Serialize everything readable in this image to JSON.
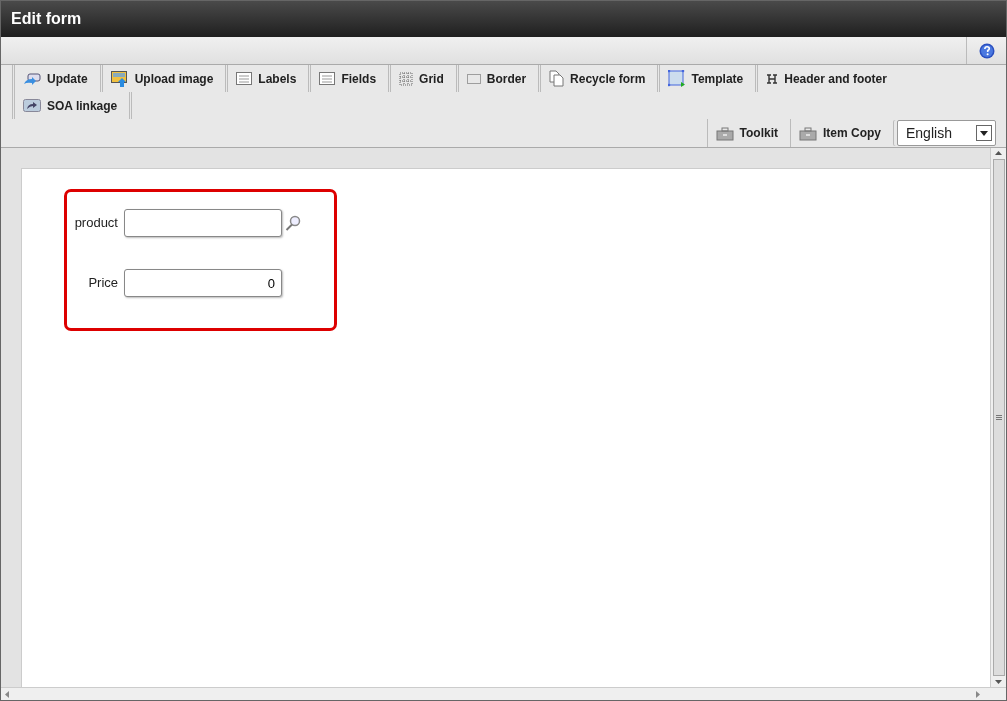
{
  "window": {
    "title": "Edit form"
  },
  "toolbar": [
    {
      "label": "Update"
    },
    {
      "label": "Upload image"
    },
    {
      "label": "Labels"
    },
    {
      "label": "Fields"
    },
    {
      "label": "Grid"
    },
    {
      "label": "Border"
    },
    {
      "label": "Recycle form"
    },
    {
      "label": "Template"
    },
    {
      "label": "Header and footer"
    },
    {
      "label": "SOA linkage"
    }
  ],
  "tools": [
    {
      "label": "Toolkit"
    },
    {
      "label": "Item Copy"
    }
  ],
  "language": {
    "value": "English"
  },
  "form": {
    "fields": [
      {
        "kind": "lookup",
        "label": "product"
      },
      {
        "kind": "number",
        "label": "Price",
        "value": "0"
      }
    ]
  }
}
